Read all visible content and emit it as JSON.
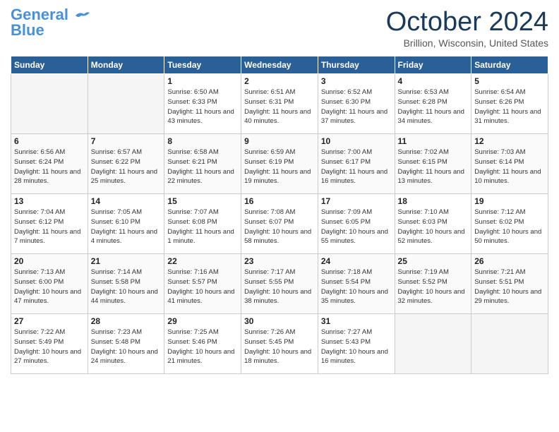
{
  "logo": {
    "line1": "General",
    "line2": "Blue"
  },
  "header": {
    "month": "October 2024",
    "location": "Brillion, Wisconsin, United States"
  },
  "days_of_week": [
    "Sunday",
    "Monday",
    "Tuesday",
    "Wednesday",
    "Thursday",
    "Friday",
    "Saturday"
  ],
  "weeks": [
    [
      {
        "day": "",
        "info": ""
      },
      {
        "day": "",
        "info": ""
      },
      {
        "day": "1",
        "info": "Sunrise: 6:50 AM\nSunset: 6:33 PM\nDaylight: 11 hours and 43 minutes."
      },
      {
        "day": "2",
        "info": "Sunrise: 6:51 AM\nSunset: 6:31 PM\nDaylight: 11 hours and 40 minutes."
      },
      {
        "day": "3",
        "info": "Sunrise: 6:52 AM\nSunset: 6:30 PM\nDaylight: 11 hours and 37 minutes."
      },
      {
        "day": "4",
        "info": "Sunrise: 6:53 AM\nSunset: 6:28 PM\nDaylight: 11 hours and 34 minutes."
      },
      {
        "day": "5",
        "info": "Sunrise: 6:54 AM\nSunset: 6:26 PM\nDaylight: 11 hours and 31 minutes."
      }
    ],
    [
      {
        "day": "6",
        "info": "Sunrise: 6:56 AM\nSunset: 6:24 PM\nDaylight: 11 hours and 28 minutes."
      },
      {
        "day": "7",
        "info": "Sunrise: 6:57 AM\nSunset: 6:22 PM\nDaylight: 11 hours and 25 minutes."
      },
      {
        "day": "8",
        "info": "Sunrise: 6:58 AM\nSunset: 6:21 PM\nDaylight: 11 hours and 22 minutes."
      },
      {
        "day": "9",
        "info": "Sunrise: 6:59 AM\nSunset: 6:19 PM\nDaylight: 11 hours and 19 minutes."
      },
      {
        "day": "10",
        "info": "Sunrise: 7:00 AM\nSunset: 6:17 PM\nDaylight: 11 hours and 16 minutes."
      },
      {
        "day": "11",
        "info": "Sunrise: 7:02 AM\nSunset: 6:15 PM\nDaylight: 11 hours and 13 minutes."
      },
      {
        "day": "12",
        "info": "Sunrise: 7:03 AM\nSunset: 6:14 PM\nDaylight: 11 hours and 10 minutes."
      }
    ],
    [
      {
        "day": "13",
        "info": "Sunrise: 7:04 AM\nSunset: 6:12 PM\nDaylight: 11 hours and 7 minutes."
      },
      {
        "day": "14",
        "info": "Sunrise: 7:05 AM\nSunset: 6:10 PM\nDaylight: 11 hours and 4 minutes."
      },
      {
        "day": "15",
        "info": "Sunrise: 7:07 AM\nSunset: 6:08 PM\nDaylight: 11 hours and 1 minute."
      },
      {
        "day": "16",
        "info": "Sunrise: 7:08 AM\nSunset: 6:07 PM\nDaylight: 10 hours and 58 minutes."
      },
      {
        "day": "17",
        "info": "Sunrise: 7:09 AM\nSunset: 6:05 PM\nDaylight: 10 hours and 55 minutes."
      },
      {
        "day": "18",
        "info": "Sunrise: 7:10 AM\nSunset: 6:03 PM\nDaylight: 10 hours and 52 minutes."
      },
      {
        "day": "19",
        "info": "Sunrise: 7:12 AM\nSunset: 6:02 PM\nDaylight: 10 hours and 50 minutes."
      }
    ],
    [
      {
        "day": "20",
        "info": "Sunrise: 7:13 AM\nSunset: 6:00 PM\nDaylight: 10 hours and 47 minutes."
      },
      {
        "day": "21",
        "info": "Sunrise: 7:14 AM\nSunset: 5:58 PM\nDaylight: 10 hours and 44 minutes."
      },
      {
        "day": "22",
        "info": "Sunrise: 7:16 AM\nSunset: 5:57 PM\nDaylight: 10 hours and 41 minutes."
      },
      {
        "day": "23",
        "info": "Sunrise: 7:17 AM\nSunset: 5:55 PM\nDaylight: 10 hours and 38 minutes."
      },
      {
        "day": "24",
        "info": "Sunrise: 7:18 AM\nSunset: 5:54 PM\nDaylight: 10 hours and 35 minutes."
      },
      {
        "day": "25",
        "info": "Sunrise: 7:19 AM\nSunset: 5:52 PM\nDaylight: 10 hours and 32 minutes."
      },
      {
        "day": "26",
        "info": "Sunrise: 7:21 AM\nSunset: 5:51 PM\nDaylight: 10 hours and 29 minutes."
      }
    ],
    [
      {
        "day": "27",
        "info": "Sunrise: 7:22 AM\nSunset: 5:49 PM\nDaylight: 10 hours and 27 minutes."
      },
      {
        "day": "28",
        "info": "Sunrise: 7:23 AM\nSunset: 5:48 PM\nDaylight: 10 hours and 24 minutes."
      },
      {
        "day": "29",
        "info": "Sunrise: 7:25 AM\nSunset: 5:46 PM\nDaylight: 10 hours and 21 minutes."
      },
      {
        "day": "30",
        "info": "Sunrise: 7:26 AM\nSunset: 5:45 PM\nDaylight: 10 hours and 18 minutes."
      },
      {
        "day": "31",
        "info": "Sunrise: 7:27 AM\nSunset: 5:43 PM\nDaylight: 10 hours and 16 minutes."
      },
      {
        "day": "",
        "info": ""
      },
      {
        "day": "",
        "info": ""
      }
    ]
  ]
}
